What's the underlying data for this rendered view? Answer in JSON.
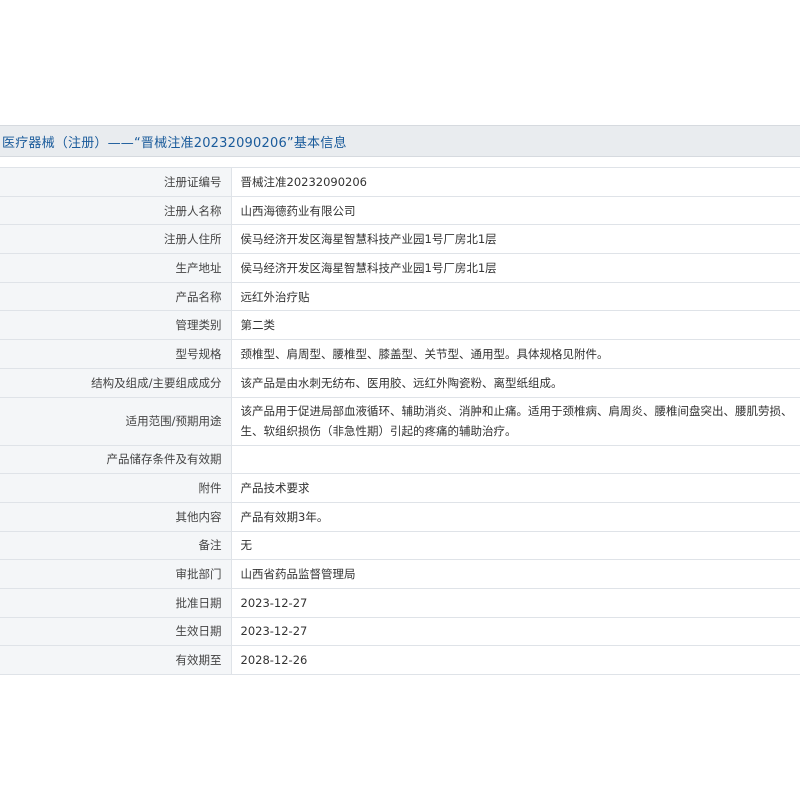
{
  "header": {
    "title": "医疗器械（注册）——“晋械注准20232090206”基本信息"
  },
  "rows": [
    {
      "label": "注册证编号",
      "value": "晋械注准20232090206"
    },
    {
      "label": "注册人名称",
      "value": "山西海德药业有限公司"
    },
    {
      "label": "注册人住所",
      "value": "侯马经济开发区海星智慧科技产业园1号厂房北1层"
    },
    {
      "label": "生产地址",
      "value": "侯马经济开发区海星智慧科技产业园1号厂房北1层"
    },
    {
      "label": "产品名称",
      "value": "远红外治疗贴"
    },
    {
      "label": "管理类别",
      "value": "第二类"
    },
    {
      "label": "型号规格",
      "value": "颈椎型、肩周型、腰椎型、膝盖型、关节型、通用型。具体规格见附件。"
    },
    {
      "label": "结构及组成/主要组成成分",
      "value": "该产品是由水刺无纺布、医用胶、远红外陶瓷粉、离型纸组成。"
    },
    {
      "label": "适用范围/预期用途",
      "value_line1": "该产品用于促进局部血液循环、辅助消炎、消肿和止痛。适用于颈椎病、肩周炎、腰椎间盘突出、腰肌劳损、",
      "value_line2": "生、软组织损伤（非急性期）引起的疼痛的辅助治疗。"
    },
    {
      "label": "产品储存条件及有效期",
      "value": ""
    },
    {
      "label": "附件",
      "value": "产品技术要求"
    },
    {
      "label": "其他内容",
      "value": "产品有效期3年。"
    },
    {
      "label": "备注",
      "value": "无"
    },
    {
      "label": "审批部门",
      "value": "山西省药品监督管理局"
    },
    {
      "label": "批准日期",
      "value": "2023-12-27"
    },
    {
      "label": "生效日期",
      "value": "2023-12-27"
    },
    {
      "label": "有效期至",
      "value": "2028-12-26"
    }
  ]
}
